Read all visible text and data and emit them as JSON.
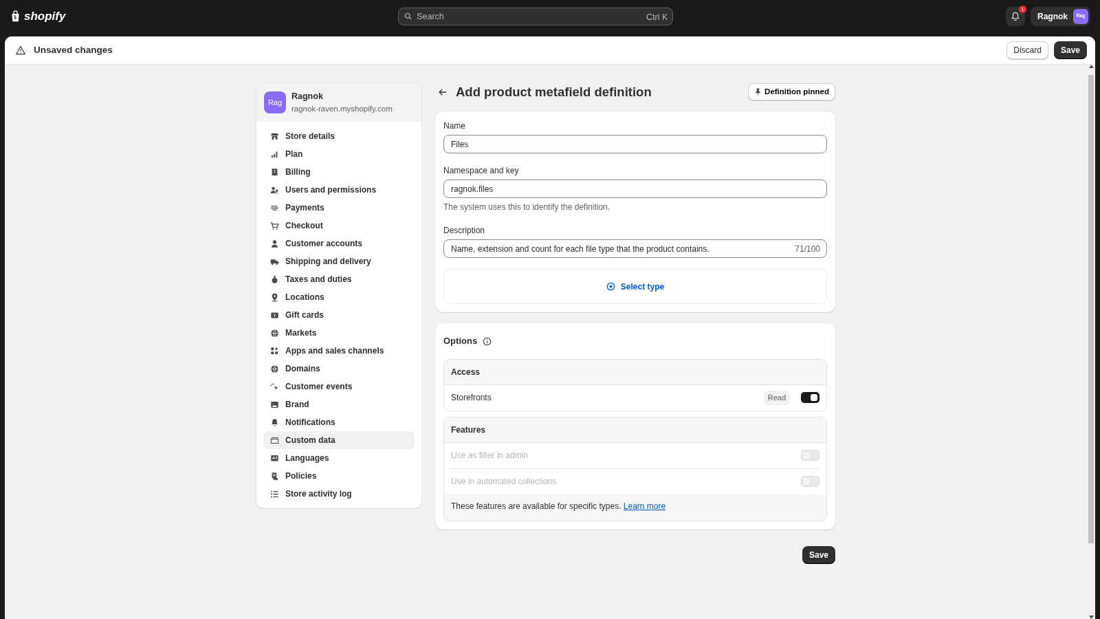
{
  "topbar": {
    "logo": "shopify",
    "search": {
      "placeholder": "Search",
      "shortcut": "Ctrl K"
    },
    "notification_count": "1",
    "account": {
      "name": "Ragnok",
      "avatar": "Rag"
    }
  },
  "save_bar": {
    "title": "Unsaved changes",
    "buttons": [
      "Discard",
      "Save"
    ]
  },
  "sidebar": {
    "store": {
      "avatar": "Rag",
      "name": "Ragnok",
      "domain": "ragnok-raven.myshopify.com"
    },
    "items": [
      {
        "label": "Store details",
        "selected": false
      },
      {
        "label": "Plan",
        "selected": false
      },
      {
        "label": "Billing",
        "selected": false
      },
      {
        "label": "Users and permissions",
        "selected": false
      },
      {
        "label": "Payments",
        "selected": false
      },
      {
        "label": "Checkout",
        "selected": false
      },
      {
        "label": "Customer accounts",
        "selected": false
      },
      {
        "label": "Shipping and delivery",
        "selected": false
      },
      {
        "label": "Taxes and duties",
        "selected": false
      },
      {
        "label": "Locations",
        "selected": false
      },
      {
        "label": "Gift cards",
        "selected": false
      },
      {
        "label": "Markets",
        "selected": false
      },
      {
        "label": "Apps and sales channels",
        "selected": false
      },
      {
        "label": "Domains",
        "selected": false
      },
      {
        "label": "Customer events",
        "selected": false
      },
      {
        "label": "Brand",
        "selected": false
      },
      {
        "label": "Notifications",
        "selected": false
      },
      {
        "label": "Custom data",
        "selected": true
      },
      {
        "label": "Languages",
        "selected": false
      },
      {
        "label": "Policies",
        "selected": false
      },
      {
        "label": "Store activity log",
        "selected": false
      }
    ]
  },
  "page": {
    "title": "Add product metafield definition",
    "pin_button": "Definition pinned",
    "fields": [
      {
        "label": "Name",
        "value": "Files"
      },
      {
        "label": "Namespace and key",
        "value": "ragnok.files",
        "help": "The system uses this to identify the definition."
      },
      {
        "label": "Description",
        "value": "Name, extension and count for each file type that the product contains.",
        "counter": "71/100"
      }
    ],
    "select_type": "Select type",
    "options": {
      "title": "Options",
      "access": {
        "title": "Access",
        "rows": [
          {
            "label": "Storefronts",
            "badge": "Read",
            "on": true
          }
        ]
      },
      "features": {
        "title": "Features",
        "rows": [
          {
            "label": "Use as filter in admin",
            "on": false,
            "disabled": true
          },
          {
            "label": "Use in automated collections",
            "on": false,
            "disabled": true
          }
        ],
        "note": "These features are available for specific types.",
        "link": "Learn more"
      }
    },
    "save_button": "Save"
  }
}
